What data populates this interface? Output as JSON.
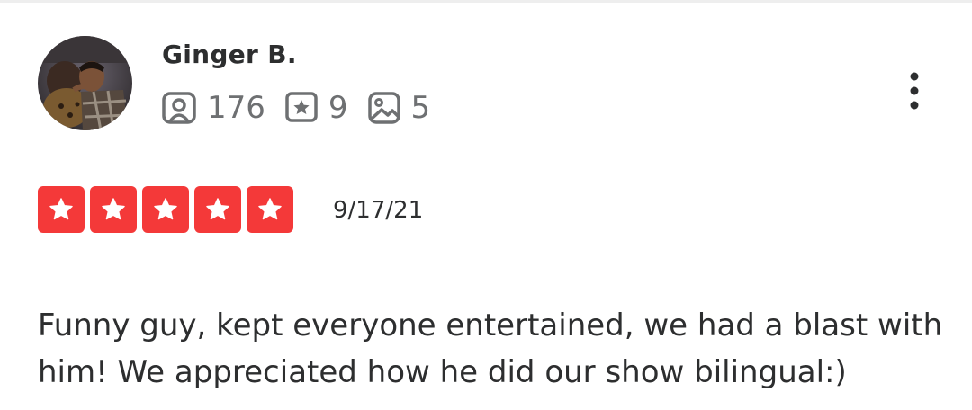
{
  "review": {
    "user": {
      "name": "Ginger B.",
      "avatar_icon": "user-photo-avatar"
    },
    "stats": {
      "friends_icon": "friends-icon",
      "friends": "176",
      "reviews_icon": "reviews-star-icon",
      "reviews": "9",
      "photos_icon": "photos-icon",
      "photos": "5"
    },
    "more_icon": "more-vertical-icon",
    "rating": {
      "value": 5,
      "max": 5,
      "star_color": "#f43939"
    },
    "date": "9/17/21",
    "text": "Funny guy, kept everyone entertained, we had a blast with him! We appreciated how he did our show bilingual:)"
  }
}
